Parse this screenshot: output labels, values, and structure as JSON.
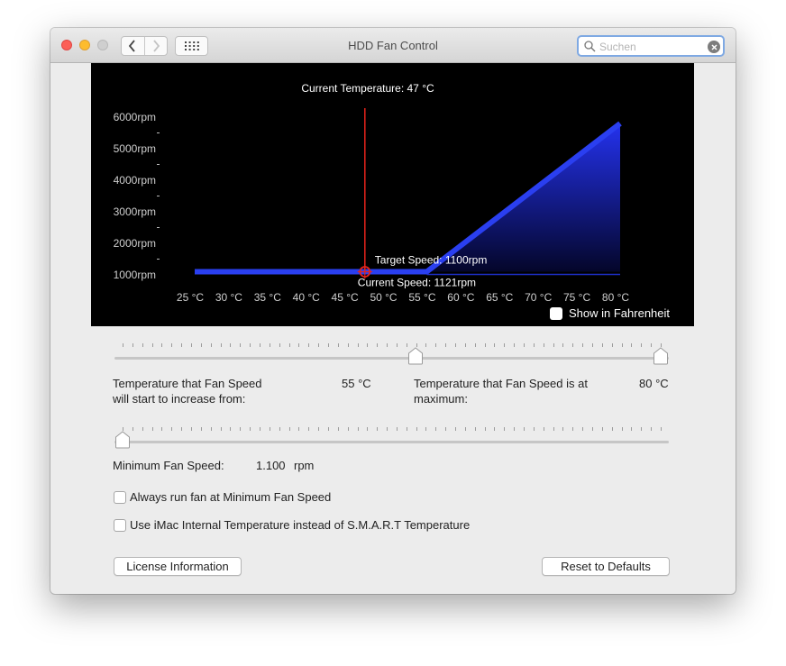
{
  "window": {
    "title": "HDD Fan Control",
    "search_placeholder": "Suchen"
  },
  "chart_data": {
    "type": "area",
    "title": "Current Temperature: 47 °C",
    "x_ticks": [
      "25 °C",
      "30 °C",
      "35 °C",
      "40 °C",
      "45 °C",
      "50 °C",
      "55 °C",
      "60 °C",
      "65 °C",
      "70 °C",
      "75 °C",
      "80 °C"
    ],
    "y_ticks": [
      "1000rpm",
      "2000rpm",
      "3000rpm",
      "4000rpm",
      "5000rpm",
      "6000rpm"
    ],
    "xlim": [
      25,
      80
    ],
    "ylim": [
      1000,
      6000
    ],
    "series": [
      {
        "values_x": [
          25,
          55,
          80
        ],
        "values_y": [
          1100,
          1100,
          5800
        ]
      }
    ],
    "current_temperature": 47,
    "target_speed": 1100,
    "current_speed": 1121,
    "annotations": {
      "target_speed": "Target Speed: 1100rpm",
      "current_speed": "Current Speed: 1121rpm"
    },
    "colors": {
      "background": "#000000",
      "curve": "#2a3ff0",
      "indicator": "#e5231b"
    }
  },
  "fahrenheit_label": "Show in Fahrenheit",
  "temp_slider": {
    "start_label": "Temperature that Fan Speed\nwill start to increase from:",
    "start_value": "55 °C",
    "start_fraction": 0.545,
    "max_label": "Temperature that Fan Speed is at\nmaximum:",
    "max_value": "80 °C",
    "max_fraction": 1.0
  },
  "min_speed": {
    "label": "Minimum Fan Speed:",
    "value": "1.100",
    "unit": "rpm",
    "fraction": 0.0
  },
  "options": {
    "always_min": "Always run fan at Minimum Fan Speed",
    "imac_temp": "Use iMac Internal Temperature instead of S.M.A.R.T Temperature"
  },
  "buttons": {
    "license": "License Information",
    "reset": "Reset to Defaults"
  }
}
